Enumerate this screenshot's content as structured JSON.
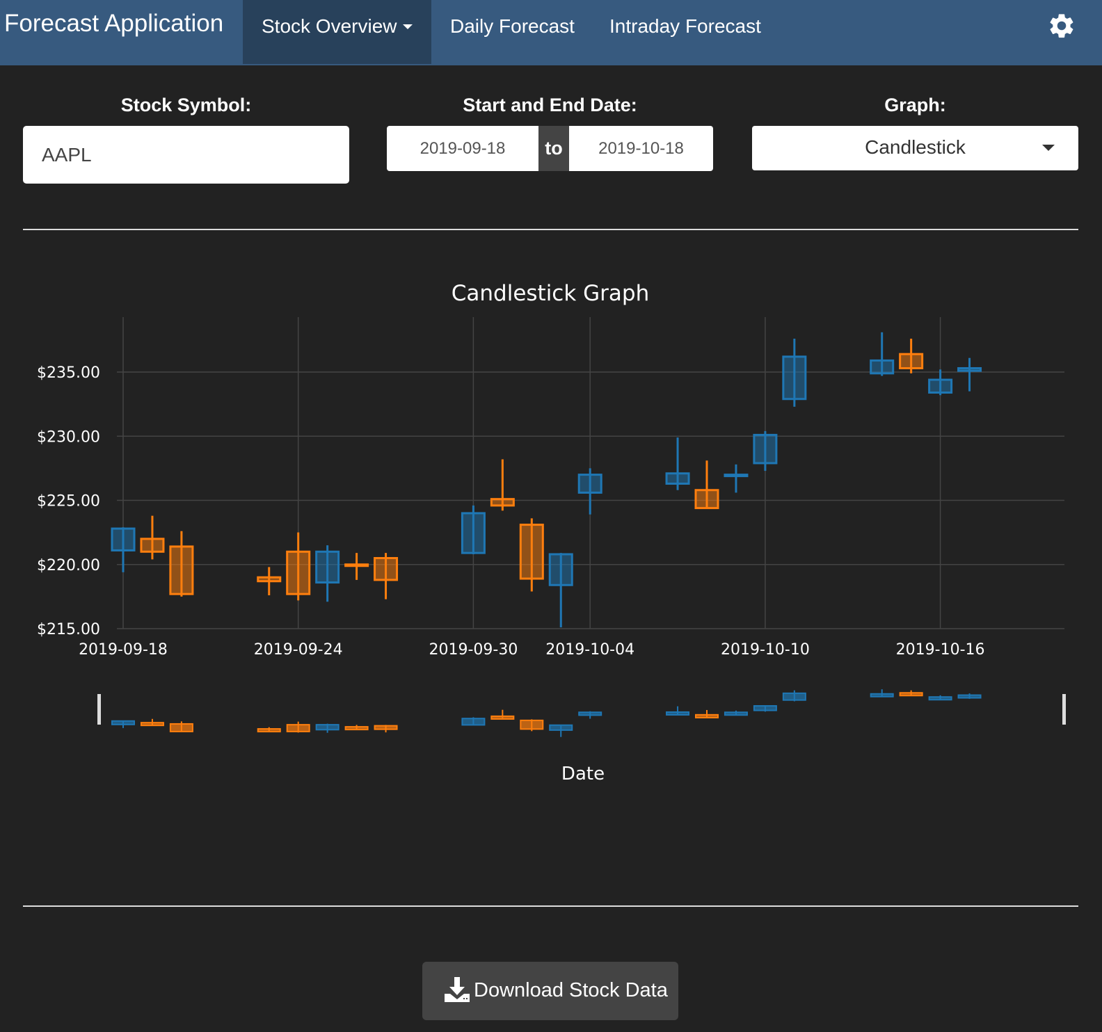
{
  "app": {
    "brand": "Forecast Application",
    "nav": {
      "stock_overview": "Stock Overview",
      "daily_forecast": "Daily Forecast",
      "intraday_forecast": "Intraday Forecast"
    }
  },
  "controls": {
    "symbol_label": "Stock Symbol:",
    "symbol_value": "AAPL",
    "dates_label": "Start and End Date:",
    "start_date": "2019-09-18",
    "date_separator": "to",
    "end_date": "2019-10-18",
    "graph_label": "Graph:",
    "graph_value": "Candlestick"
  },
  "download": {
    "label": "Download Stock Data"
  },
  "colors": {
    "navbar": "#375a7f",
    "background": "#222222",
    "increasing": "#1f77b4",
    "decreasing": "#ff7f0e"
  },
  "icons": {
    "settings": "gear-icon",
    "nav_dropdown": "caret-down-icon",
    "select_dropdown": "caret-down-icon",
    "download": "download-icon"
  },
  "chart_data": {
    "type": "candlestick",
    "title": "Candlestick Graph",
    "xlabel": "Date",
    "ylabel": "",
    "ylim": [
      215,
      238.5
    ],
    "y_ticks": [
      "$215.00",
      "$220.00",
      "$225.00",
      "$230.00",
      "$235.00"
    ],
    "x_ticks": [
      "2019-09-18",
      "2019-09-24",
      "2019-09-30",
      "2019-10-04",
      "2019-10-10",
      "2019-10-16"
    ],
    "rangeslider": true,
    "grid": true,
    "candles": [
      {
        "date": "2019-09-18",
        "open": 221.1,
        "high": 222.9,
        "low": 219.4,
        "close": 222.8
      },
      {
        "date": "2019-09-19",
        "open": 222.0,
        "high": 223.8,
        "low": 220.4,
        "close": 221.0
      },
      {
        "date": "2019-09-20",
        "open": 221.4,
        "high": 222.6,
        "low": 217.5,
        "close": 217.7
      },
      {
        "date": "2019-09-23",
        "open": 219.0,
        "high": 219.8,
        "low": 217.6,
        "close": 218.7
      },
      {
        "date": "2019-09-24",
        "open": 221.0,
        "high": 222.5,
        "low": 217.2,
        "close": 217.7
      },
      {
        "date": "2019-09-25",
        "open": 218.6,
        "high": 221.5,
        "low": 217.1,
        "close": 221.0
      },
      {
        "date": "2019-09-26",
        "open": 220.0,
        "high": 220.9,
        "low": 218.8,
        "close": 219.9
      },
      {
        "date": "2019-09-27",
        "open": 220.5,
        "high": 220.9,
        "low": 217.3,
        "close": 218.8
      },
      {
        "date": "2019-09-30",
        "open": 220.9,
        "high": 224.6,
        "low": 220.8,
        "close": 224.0
      },
      {
        "date": "2019-10-01",
        "open": 225.1,
        "high": 228.2,
        "low": 224.2,
        "close": 224.6
      },
      {
        "date": "2019-10-02",
        "open": 223.1,
        "high": 223.6,
        "low": 217.9,
        "close": 218.9
      },
      {
        "date": "2019-10-03",
        "open": 218.4,
        "high": 220.9,
        "low": 215.1,
        "close": 220.8
      },
      {
        "date": "2019-10-04",
        "open": 225.6,
        "high": 227.5,
        "low": 223.9,
        "close": 227.0
      },
      {
        "date": "2019-10-07",
        "open": 226.3,
        "high": 229.9,
        "low": 225.8,
        "close": 227.1
      },
      {
        "date": "2019-10-08",
        "open": 225.8,
        "high": 228.1,
        "low": 224.4,
        "close": 224.4
      },
      {
        "date": "2019-10-09",
        "open": 227.0,
        "high": 227.8,
        "low": 225.6,
        "close": 227.0
      },
      {
        "date": "2019-10-10",
        "open": 227.9,
        "high": 230.4,
        "low": 227.3,
        "close": 230.1
      },
      {
        "date": "2019-10-11",
        "open": 232.9,
        "high": 237.6,
        "low": 232.3,
        "close": 236.2
      },
      {
        "date": "2019-10-14",
        "open": 234.9,
        "high": 238.1,
        "low": 234.7,
        "close": 235.9
      },
      {
        "date": "2019-10-15",
        "open": 236.4,
        "high": 237.6,
        "low": 234.9,
        "close": 235.3
      },
      {
        "date": "2019-10-16",
        "open": 233.4,
        "high": 235.2,
        "low": 233.2,
        "close": 234.4
      },
      {
        "date": "2019-10-17",
        "open": 235.1,
        "high": 236.1,
        "low": 233.5,
        "close": 235.3
      }
    ]
  }
}
